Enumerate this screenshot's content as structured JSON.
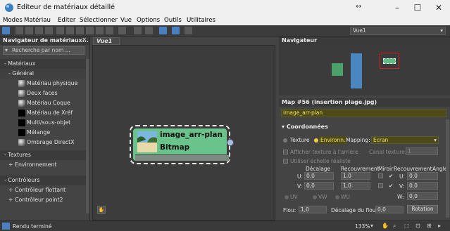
{
  "window": {
    "title": "Editeur de matériaux détaillé"
  },
  "menu": [
    "Modes",
    "Matériau",
    "Editer",
    "Sélectionner",
    "Vue",
    "Options",
    "Outils",
    "Utilitaires"
  ],
  "toolbar": {
    "view_selector": "Vue1"
  },
  "browser": {
    "title": "Navigateur de matériaux...",
    "search_placeholder": "Recherche par nom ...",
    "materials_group": "- Matériaux",
    "general_group": "- Général",
    "materials": [
      {
        "label": "Matériau physique",
        "swatch": "sphere"
      },
      {
        "label": "Deux faces",
        "swatch": "sphere"
      },
      {
        "label": "Matériau Coque",
        "swatch": "sphere"
      },
      {
        "label": "Matériau de Xréf",
        "swatch": "black"
      },
      {
        "label": "Multi/sous-objet",
        "swatch": "black"
      },
      {
        "label": "Mélange",
        "swatch": "black"
      },
      {
        "label": "Ombrage DirectX",
        "swatch": "sphere"
      }
    ],
    "textures_group": "- Textures",
    "environment_item": "+ Environnement",
    "controllers_group": "- Contrôleurs",
    "controller_items": [
      "+ Contrôleur flottant",
      "+ Contrôleur point2"
    ]
  },
  "view": {
    "tab": "Vue1",
    "node": {
      "title": "image_arr-plan",
      "type": "Bitmap"
    }
  },
  "navigator": {
    "title": "Navigateur"
  },
  "params": {
    "title": "Map #56  (insertion plage.jpg)",
    "map_name": "image_arr-plan",
    "rollout": "Coordonnées",
    "texture_label": "Texture",
    "environment_label": "Environn.",
    "mapping_label": "Mapping:",
    "mapping_value": "Ecran",
    "show_back": "Afficher texture à l'arrière",
    "real_scale": "Utiliser échelle réaliste",
    "map_channel_label": "Canal texture:",
    "map_channel_value": "1",
    "col_offset": "Décalage",
    "col_tiling": "Recouvrement",
    "col_mirror": "Miroir",
    "col_tile": "Recouvrement",
    "col_angle": "Angle",
    "u_label": "U:",
    "v_label": "V:",
    "w_label": "W:",
    "u_offset": "0,0",
    "v_offset": "0,0",
    "u_tiling": "1,0",
    "v_tiling": "1,0",
    "u_angle": "0,0",
    "v_angle": "0,0",
    "w_angle": "0,0",
    "uv": "UV",
    "vw": "VW",
    "wu": "WU",
    "blur_label": "Flou:",
    "blur_value": "1,0",
    "blur_offset_label": "Décalage du flou:",
    "blur_offset_value": "0,0",
    "rotation_button": "Rotation"
  },
  "status": {
    "text": "Rendu terminé",
    "zoom": "133%"
  },
  "colors": {
    "accent": "#4a7fc0",
    "node": "#6bc38c",
    "highlight_field": "#4d4a17",
    "highlight_text": "#f0e060"
  }
}
